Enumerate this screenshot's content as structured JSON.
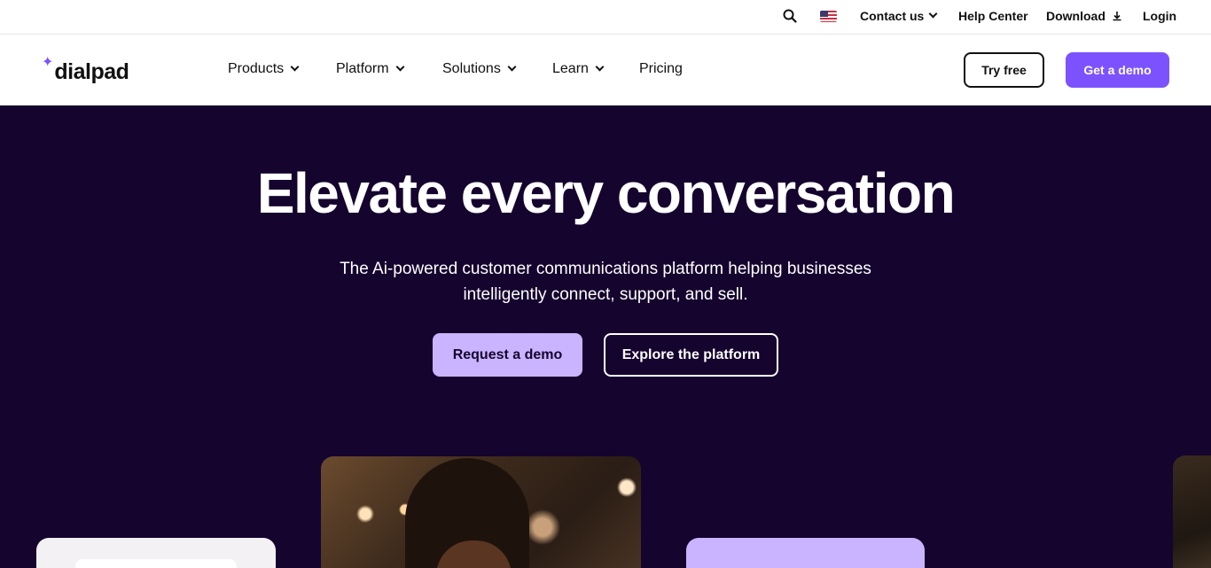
{
  "utility": {
    "contact_label": "Contact us",
    "help_label": "Help Center",
    "download_label": "Download",
    "login_label": "Login",
    "search_icon": "search-icon",
    "flag_icon": "us-flag-icon"
  },
  "nav": {
    "logo_text": "dialpad",
    "items": [
      {
        "label": "Products",
        "has_dropdown": true
      },
      {
        "label": "Platform",
        "has_dropdown": true
      },
      {
        "label": "Solutions",
        "has_dropdown": true
      },
      {
        "label": "Learn",
        "has_dropdown": true
      },
      {
        "label": "Pricing",
        "has_dropdown": false
      }
    ],
    "try_free_label": "Try free",
    "get_demo_label": "Get a demo"
  },
  "hero": {
    "title": "Elevate every conversation",
    "subtitle_line1": "The Ai-powered customer communications platform helping businesses",
    "subtitle_line2": "intelligently connect, support, and sell.",
    "primary_cta": "Request a demo",
    "secondary_cta": "Explore the platform"
  },
  "colors": {
    "brand_purple": "#7c52ff",
    "hero_bg": "#15042e",
    "light_purple": "#cbb4ff"
  }
}
